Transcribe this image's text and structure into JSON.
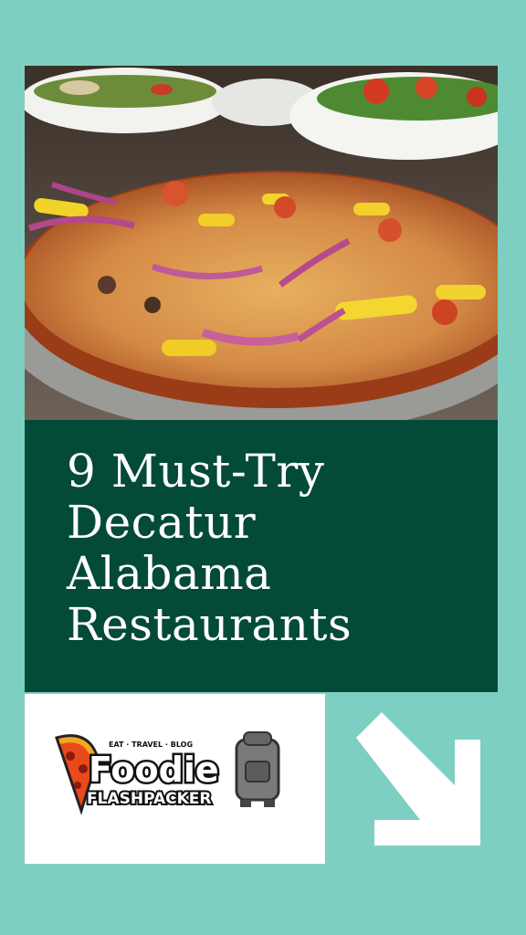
{
  "hero": {
    "image_description_icon": "pizza-photo"
  },
  "title": {
    "lines": [
      "9 Must-Try",
      "Decatur",
      "Alabama",
      "Restaurants"
    ]
  },
  "logo": {
    "tagline": "EAT · TRAVEL · BLOG",
    "word1": "Foodie",
    "word2": "FLASHPACKER"
  },
  "colors": {
    "background": "#7dcfc1",
    "title_bg": "#044a38",
    "title_text": "#ffffff",
    "logo_bg": "#ffffff"
  },
  "arrow_icon": "arrow-down-right-icon"
}
